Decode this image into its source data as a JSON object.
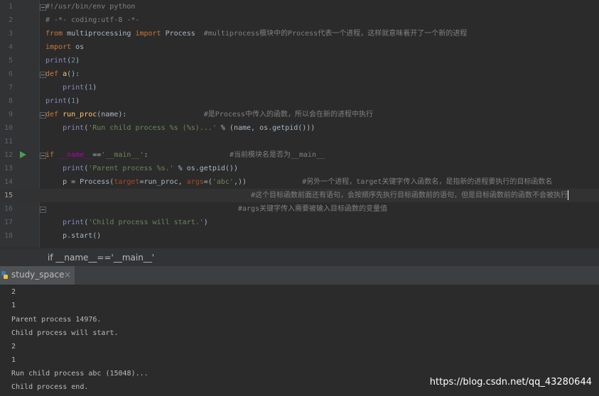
{
  "editor": {
    "lines": [
      {
        "n": "1",
        "c": "#!/usr/bin/env python"
      },
      {
        "n": "2",
        "c": "# -*- coding:utf-8 -*-"
      },
      {
        "n": "3",
        "c": "from multiprocessing import Process  #multiprocess模块中的Process代表一个进程，这样就意味着开了一个新的进程"
      },
      {
        "n": "4",
        "c": "import os"
      },
      {
        "n": "5",
        "c": "print(2)"
      },
      {
        "n": "6",
        "c": "def a():"
      },
      {
        "n": "7",
        "c": "    print(1)"
      },
      {
        "n": "8",
        "c": "print(1)"
      },
      {
        "n": "9",
        "c": "def run_proc(name):                  #是Process中传入的函数，所以会在新的进程中执行"
      },
      {
        "n": "10",
        "c": "    print('Run child process %s (%s)...' % (name, os.getpid()))"
      },
      {
        "n": "11",
        "c": ""
      },
      {
        "n": "12",
        "c": "if __name__=='__main__':                   #当前模块名是否为__main__"
      },
      {
        "n": "13",
        "c": "    print('Parent process %s.' % os.getpid())"
      },
      {
        "n": "14",
        "c": "    p = Process(target=run_proc, args=('abc',))             #另外一个进程，target关键字传入函数名，是指新的进程要执行的目标函数名"
      },
      {
        "n": "15",
        "c": "                                                #这个目标函数前面还有语句，会按顺序先执行目标函数前的语句，但是目标函数前的函数不会被执行"
      },
      {
        "n": "16",
        "c": "                                             #args关键字传入需要被输入目标函数的变量值"
      },
      {
        "n": "17",
        "c": "    print('Child process will start.')"
      },
      {
        "n": "18",
        "c": "    p.start()"
      }
    ],
    "breadcrumb": "if __name__=='__main__'"
  },
  "run_tab": {
    "label": "study_space",
    "close": "×"
  },
  "console": {
    "lines": [
      "2",
      "1",
      "Parent process 14976.",
      "Child process will start.",
      "2",
      "1",
      "Run child process abc (15048)...",
      "Child process end."
    ]
  },
  "watermark": "https://blog.csdn.net/qq_43280644"
}
